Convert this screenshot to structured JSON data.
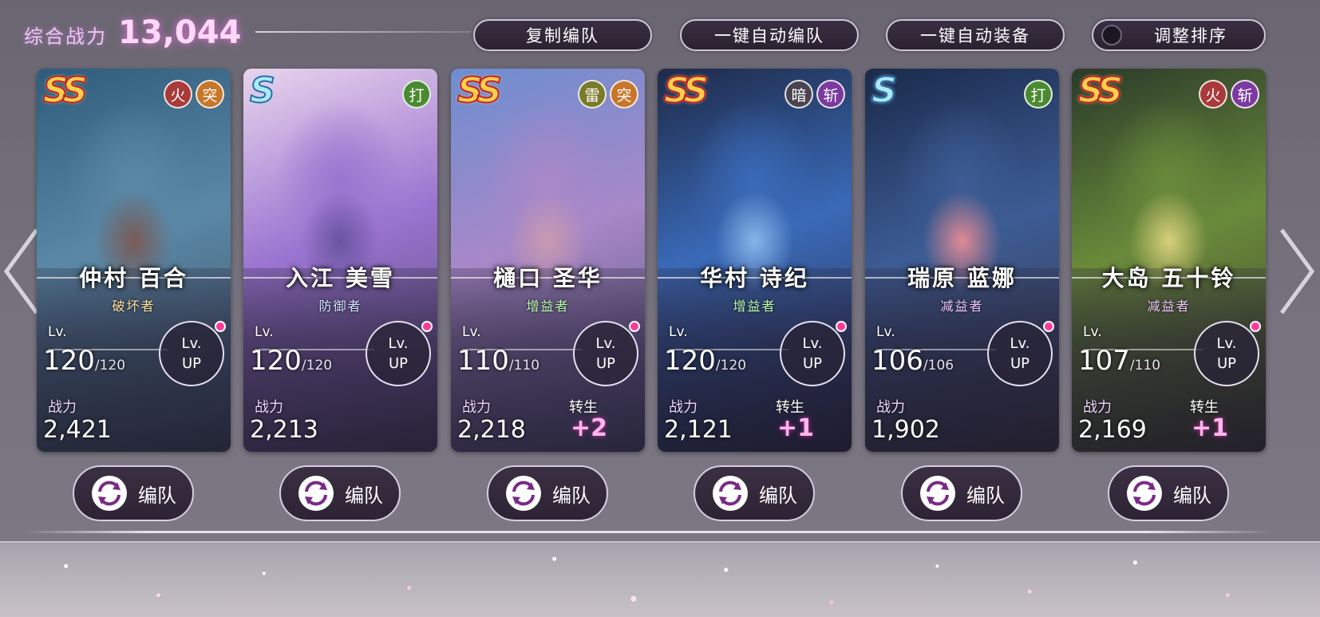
{
  "header": {
    "power_label": "综合战力",
    "power_value": "13,044"
  },
  "top_buttons": {
    "copy_team": "复制编队",
    "auto_team": "一键自动编队",
    "auto_equip": "一键自动装备",
    "adjust_order": "调整排序"
  },
  "cards": [
    {
      "rank": "SS",
      "tags": [
        {
          "label": "火",
          "color": "#a83a3a"
        },
        {
          "label": "突",
          "color": "#c7762a"
        }
      ],
      "name": "仲村 百合",
      "role": "破坏者",
      "role_color": "#ffe1a0",
      "lv_label": "Lv.",
      "lv": "120",
      "lv_max": "/120",
      "lvup_line1": "Lv.",
      "lvup_line2": "UP",
      "power_label": "战力",
      "power": "2,421",
      "rebirth_label": "",
      "rebirth": "",
      "art": [
        "#2e5c7a",
        "#5a88a6",
        "#7a5a55",
        "#3d4a5c"
      ]
    },
    {
      "rank": "S",
      "tags": [
        {
          "label": "打",
          "color": "#4c8a32"
        }
      ],
      "name": "入江 美雪",
      "role": "防御者",
      "role_color": "#cfe6ff",
      "lv_label": "Lv.",
      "lv": "120",
      "lv_max": "/120",
      "lvup_line1": "Lv.",
      "lvup_line2": "UP",
      "power_label": "战力",
      "power": "2,213",
      "rebirth_label": "",
      "rebirth": "",
      "art": [
        "#e8d4ec",
        "#9a74d0",
        "#6a54a0",
        "#4c4064"
      ]
    },
    {
      "rank": "SS",
      "tags": [
        {
          "label": "雷",
          "color": "#7a7a2a"
        },
        {
          "label": "突",
          "color": "#c7762a"
        }
      ],
      "name": "樋口 圣华",
      "role": "增益者",
      "role_color": "#b8ffb0",
      "lv_label": "Lv.",
      "lv": "110",
      "lv_max": "/110",
      "lvup_line1": "Lv.",
      "lvup_line2": "UP",
      "power_label": "战力",
      "power": "2,218",
      "rebirth_label": "转生",
      "rebirth": "+2",
      "art": [
        "#6c8ed0",
        "#a888c8",
        "#c89ab0",
        "#4a4a70"
      ]
    },
    {
      "rank": "SS",
      "tags": [
        {
          "label": "暗",
          "color": "#4a4450"
        },
        {
          "label": "斩",
          "color": "#7a3aa0"
        }
      ],
      "name": "华村 诗纪",
      "role": "增益者",
      "role_color": "#b8ffb0",
      "lv_label": "Lv.",
      "lv": "120",
      "lv_max": "/120",
      "lvup_line1": "Lv.",
      "lvup_line2": "UP",
      "power_label": "战力",
      "power": "2,121",
      "rebirth_label": "转生",
      "rebirth": "+1",
      "art": [
        "#1e2a48",
        "#3a6ab8",
        "#86b4e8",
        "#2a2840"
      ]
    },
    {
      "rank": "S",
      "tags": [
        {
          "label": "打",
          "color": "#4c8a32"
        }
      ],
      "name": "瑞原 蓝娜",
      "role": "减益者",
      "role_color": "#f0c8ff",
      "lv_label": "Lv.",
      "lv": "106",
      "lv_max": "/106",
      "lvup_line1": "Lv.",
      "lvup_line2": "UP",
      "power_label": "战力",
      "power": "1,902",
      "rebirth_label": "",
      "rebirth": "",
      "art": [
        "#1a2a4a",
        "#3c5c94",
        "#e08a94",
        "#3a3440"
      ]
    },
    {
      "rank": "SS",
      "tags": [
        {
          "label": "火",
          "color": "#a83a3a"
        },
        {
          "label": "斩",
          "color": "#7a3aa0"
        }
      ],
      "name": "大岛 五十铃",
      "role": "减益者",
      "role_color": "#f0c8ff",
      "lv_label": "Lv.",
      "lv": "107",
      "lv_max": "/110",
      "lvup_line1": "Lv.",
      "lvup_line2": "UP",
      "power_label": "战力",
      "power": "2,169",
      "rebirth_label": "转生",
      "rebirth": "+1",
      "art": [
        "#2a3a2a",
        "#6a8a3a",
        "#d8d07a",
        "#3a3a30"
      ]
    }
  ],
  "team_button_label": "编队"
}
